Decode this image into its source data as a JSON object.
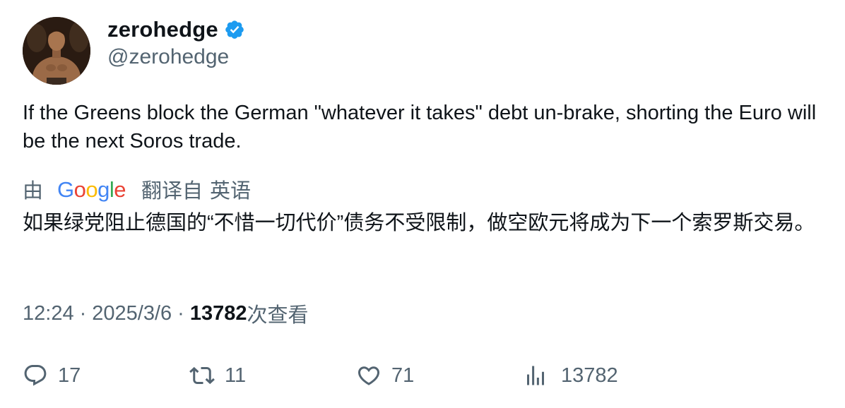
{
  "author": {
    "display_name": "zerohedge",
    "handle": "@zerohedge",
    "verified": true,
    "badge_color": "#1d9bf0"
  },
  "tweet": {
    "text": "If the Greens block the German \"whatever it takes\" debt un-brake, shorting the Euro will be the next Soros trade.",
    "translation_by": "由",
    "translation_provider": "Google",
    "translation_from": "翻译自",
    "translation_language": "英语",
    "translated_text": "如果绿党阻止德国的“不惜一切代价”债务不受限制，做空欧元将成为下一个索罗斯交易。"
  },
  "meta": {
    "time": "12:24",
    "date": "2025/3/6",
    "separator": "·",
    "views_count": "13782",
    "views_label": "次查看"
  },
  "actions": {
    "replies": "17",
    "retweets": "11",
    "likes": "71",
    "views": "13782"
  },
  "icons": {
    "reply": "reply-icon",
    "retweet": "retweet-icon",
    "like": "heart-icon",
    "views": "analytics-icon",
    "verified": "verified-badge-icon"
  },
  "colors": {
    "text_primary": "#0f1419",
    "text_secondary": "#536471",
    "google_blue": "#4285f4",
    "google_red": "#ea4335",
    "google_yellow": "#fbbc05",
    "google_green": "#34a853"
  }
}
